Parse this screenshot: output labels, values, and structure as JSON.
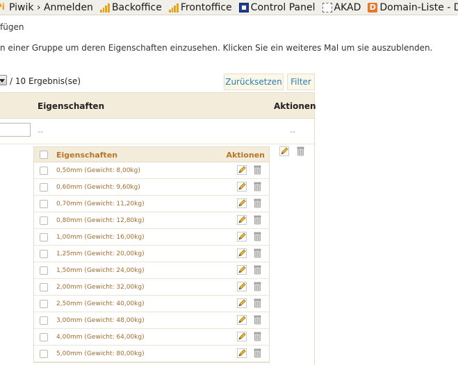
{
  "bookmarks": [
    {
      "label": "Piwik › Anmelden",
      "icon": "piwik-icon"
    },
    {
      "label": "Backoffice",
      "icon": "bar-chart-icon"
    },
    {
      "label": "Frontoffice",
      "icon": "bar-chart-icon"
    },
    {
      "label": "Control Panel",
      "icon": "1und1-icon"
    },
    {
      "label": "AKAD",
      "icon": "dashed-square-icon"
    },
    {
      "label": "Domain-Liste - Do",
      "icon": "d-icon"
    }
  ],
  "page": {
    "add_text": "fügen",
    "help_text": "n einer Gruppe um deren Eigenschaften einzusehen. Klicken Sie ein weiteres Mal um sie auszublenden."
  },
  "pager": {
    "results_text": "/ 10 Ergebnis(se)"
  },
  "buttons": {
    "reset": "Zurücksetzen",
    "filter": "Filter"
  },
  "main_table": {
    "col_properties": "Eigenschaften",
    "col_actions": "Aktionen",
    "filter_dash_properties": "--",
    "filter_dash_actions": "--"
  },
  "sub_table": {
    "col_properties": "Eigenschaften",
    "col_actions": "Aktionen",
    "rows": [
      "0,50mm (Gewicht: 8,00kg)",
      "0,60mm (Gewicht: 9,60kg)",
      "0,70mm (Gewicht: 11,20kg)",
      "0,80mm (Gewicht: 12,80kg)",
      "1,00mm (Gewicht: 16,00kg)",
      "1,25mm (Gewicht: 20,00kg)",
      "1,50mm (Gewicht: 24,00kg)",
      "2,00mm (Gewicht: 32,00kg)",
      "2,50mm (Gewicht: 40,00kg)",
      "3,00mm (Gewicht: 48,00kg)",
      "4,00mm (Gewicht: 64,00kg)",
      "5,00mm (Gewicht: 80,00kg)"
    ]
  }
}
